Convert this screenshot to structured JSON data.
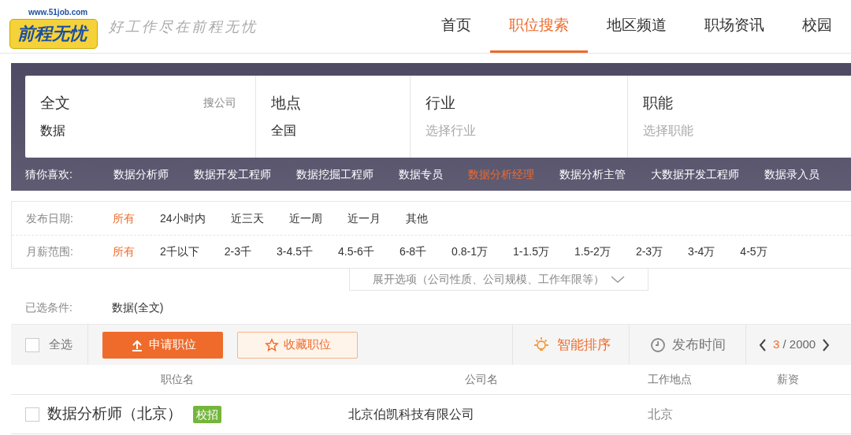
{
  "header": {
    "logo_url": "www.51job.com",
    "logo_name": "前程无忧",
    "slogan": "好工作尽在前程无忧",
    "nav": [
      {
        "label": "首页",
        "selected": false
      },
      {
        "label": "职位搜索",
        "selected": true
      },
      {
        "label": "地区频道",
        "selected": false
      },
      {
        "label": "职场资讯",
        "selected": false
      },
      {
        "label": "校园",
        "selected": false
      }
    ]
  },
  "search": {
    "fields": [
      {
        "label": "全文",
        "value": "数据",
        "side_link": "搜公司"
      },
      {
        "label": "地点",
        "value": "全国"
      },
      {
        "label": "行业",
        "placeholder": "选择行业"
      },
      {
        "label": "职能",
        "placeholder": "选择职能"
      }
    ],
    "suggest_label": "猜你喜欢:",
    "suggestions": [
      {
        "label": "数据分析师",
        "selected": false
      },
      {
        "label": "数据开发工程师",
        "selected": false
      },
      {
        "label": "数据挖掘工程师",
        "selected": false
      },
      {
        "label": "数据专员",
        "selected": false
      },
      {
        "label": "数据分析经理",
        "selected": true
      },
      {
        "label": "数据分析主管",
        "selected": false
      },
      {
        "label": "大数据开发工程师",
        "selected": false
      },
      {
        "label": "数据录入员",
        "selected": false
      }
    ]
  },
  "filters": [
    {
      "label": "发布日期:",
      "options": [
        {
          "label": "所有",
          "selected": true
        },
        {
          "label": "24小时内",
          "selected": false
        },
        {
          "label": "近三天",
          "selected": false
        },
        {
          "label": "近一周",
          "selected": false
        },
        {
          "label": "近一月",
          "selected": false
        },
        {
          "label": "其他",
          "selected": false
        }
      ]
    },
    {
      "label": "月薪范围:",
      "options": [
        {
          "label": "所有",
          "selected": true
        },
        {
          "label": "2千以下",
          "selected": false
        },
        {
          "label": "2-3千",
          "selected": false
        },
        {
          "label": "3-4.5千",
          "selected": false
        },
        {
          "label": "4.5-6千",
          "selected": false
        },
        {
          "label": "6-8千",
          "selected": false
        },
        {
          "label": "0.8-1万",
          "selected": false
        },
        {
          "label": "1-1.5万",
          "selected": false
        },
        {
          "label": "1.5-2万",
          "selected": false
        },
        {
          "label": "2-3万",
          "selected": false
        },
        {
          "label": "3-4万",
          "selected": false
        },
        {
          "label": "4-5万",
          "selected": false
        }
      ]
    }
  ],
  "expand_button": "展开选项（公司性质、公司规模、工作年限等）",
  "selected_conditions": {
    "label": "已选条件:",
    "value": "数据(全文)"
  },
  "toolbar": {
    "select_all": {
      "label": "全选",
      "checked": false
    },
    "apply_button": "申请职位",
    "save_button": "收藏职位",
    "sorts": [
      {
        "label": "智能排序",
        "kind": "bulb",
        "selected": true
      },
      {
        "label": "发布时间",
        "kind": "clock",
        "selected": false
      }
    ],
    "page_current": "3",
    "page_total": "/ 2000"
  },
  "table": {
    "columns": [
      "职位名",
      "公司名",
      "工作地点",
      "薪资"
    ],
    "rows": [
      {
        "checked": false,
        "title": "数据分析师（北京）",
        "tag": "校招",
        "company": "北京伯凯科技有限公司",
        "location": "北京"
      }
    ]
  }
}
